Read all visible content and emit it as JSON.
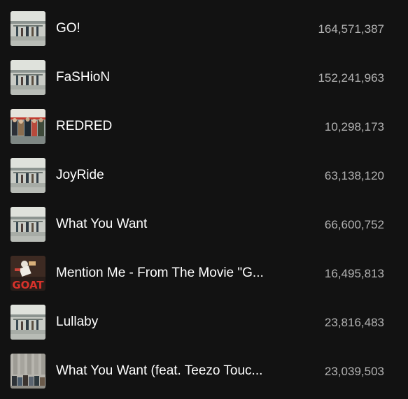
{
  "tracks": [
    {
      "title": "GO!",
      "plays": "164,571,387",
      "cover": "street-photo-cover"
    },
    {
      "title": "FaSHioN",
      "plays": "152,241,963",
      "cover": "street-photo-cover"
    },
    {
      "title": "REDRED",
      "plays": "10,298,173",
      "cover": "group-photo-cover"
    },
    {
      "title": "JoyRide",
      "plays": "63,138,120",
      "cover": "street-photo-cover"
    },
    {
      "title": "What You Want",
      "plays": "66,600,752",
      "cover": "street-photo-cover"
    },
    {
      "title": "Mention Me - From The Movie \"G...",
      "plays": "16,495,813",
      "cover": "goat-movie-cover",
      "cover_text": "GOAT"
    },
    {
      "title": "Lullaby",
      "plays": "23,816,483",
      "cover": "street-photo-cover"
    },
    {
      "title": "What You Want (feat. Teezo Touc...",
      "plays": "23,039,503",
      "cover": "building-group-cover"
    }
  ]
}
